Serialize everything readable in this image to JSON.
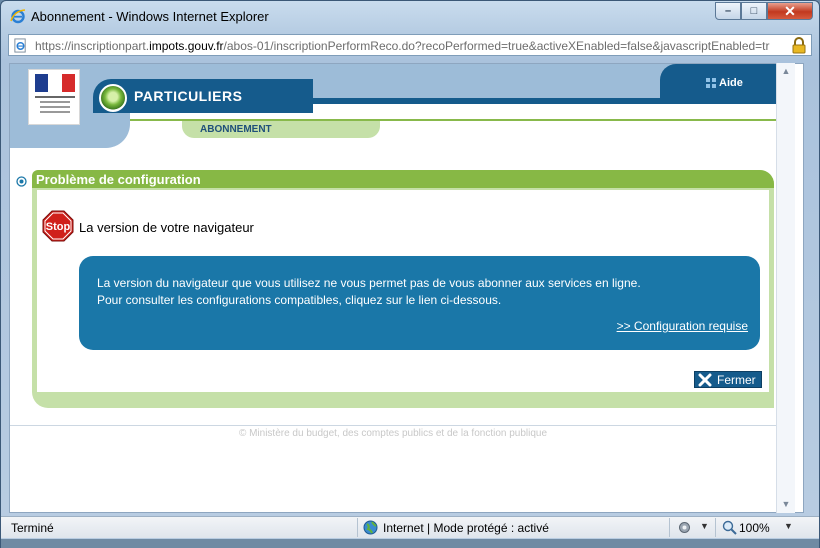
{
  "window": {
    "title": "Abonnement - Windows Internet Explorer",
    "url_prefix": "https://inscriptionpart.",
    "url_domain": "impots.gouv.fr",
    "url_path": "/abos-01/inscriptionPerformReco.do?recoPerformed=true&activeXEnabled=false&javascriptEnabled=tr",
    "minimize_glyph": "–",
    "maximize_glyph": "□",
    "close_glyph": "✕"
  },
  "header": {
    "site_section": "PARTICULIERS",
    "help_label": "Aide",
    "sub_tab": "ABONNEMENT"
  },
  "section": {
    "title": "Problème de configuration",
    "stop_badge": "Stop",
    "message_title": "La version de votre navigateur",
    "info_line1": "La version du navigateur que vous utilisez ne vous permet pas de vous abonner aux services en ligne.",
    "info_line2": "Pour consulter les configurations compatibles, cliquez sur le lien ci-dessous.",
    "info_link": ">> Configuration requise",
    "close_button": "Fermer"
  },
  "footer": {
    "copyright": "© Ministère du budget, des comptes publics et de la fonction publique"
  },
  "statusbar": {
    "status": "Terminé",
    "zone": "Internet | Mode protégé : activé",
    "zoom": "100%",
    "dropdown_glyph": "▼"
  },
  "colors": {
    "brand_blue": "#155b8c",
    "brand_green": "#87b845",
    "info_blue": "#1a77a8",
    "stop_red": "#d0201b"
  }
}
